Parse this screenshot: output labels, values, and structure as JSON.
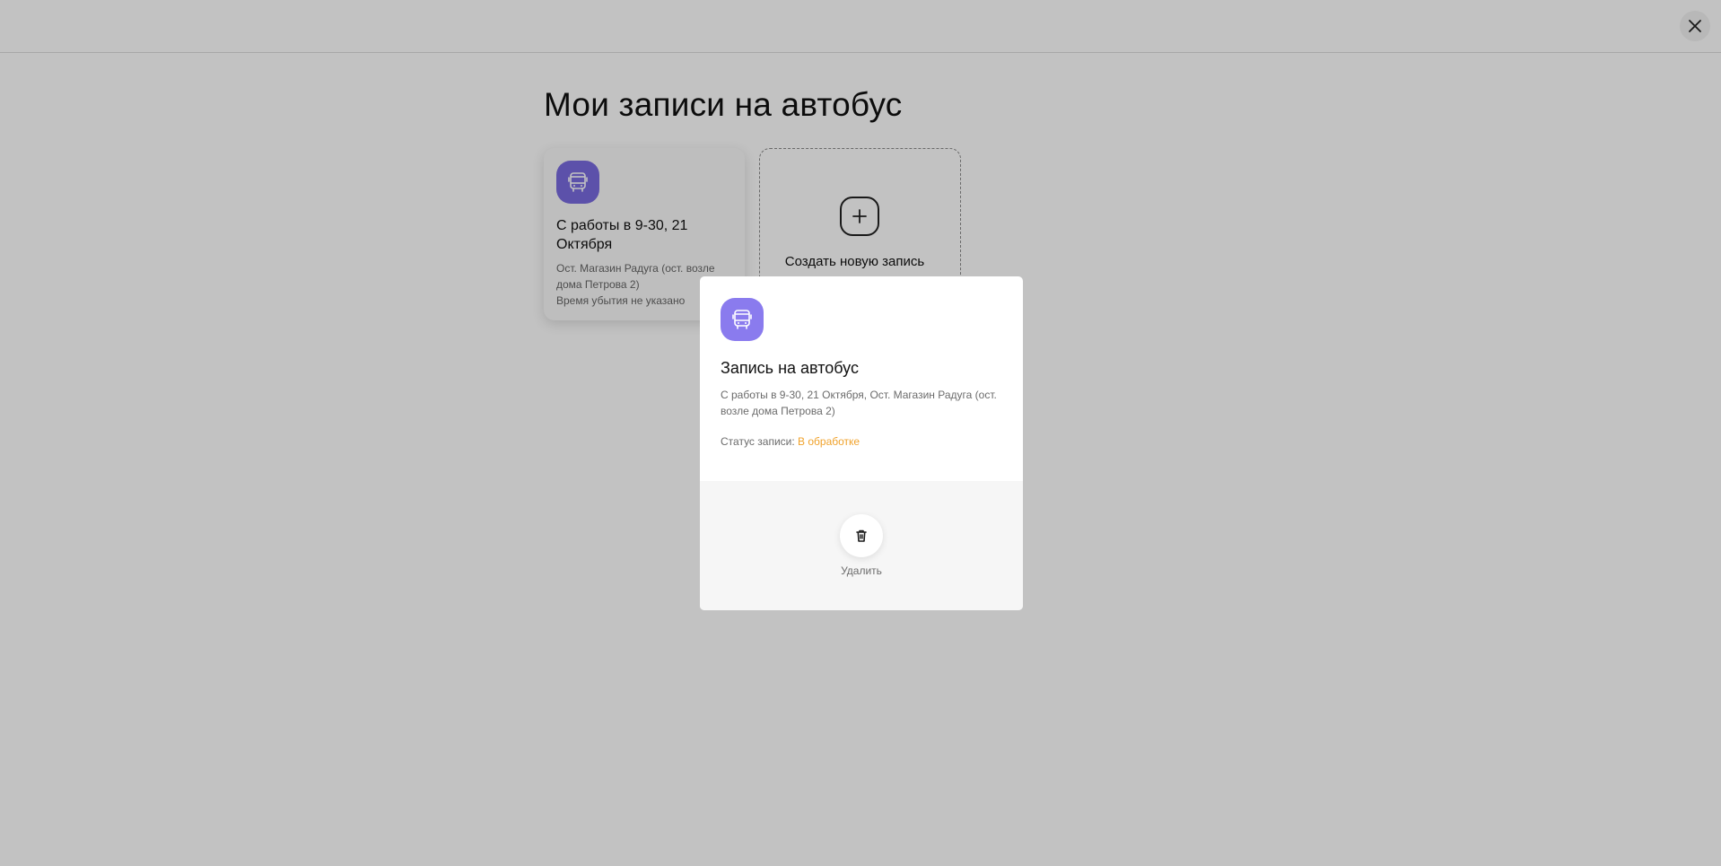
{
  "page": {
    "title": "Мои записи на автобус"
  },
  "header": {
    "close_icon": "close-icon"
  },
  "colors": {
    "accent_purple": "#7a6be0",
    "status_processing": "#f0a22b"
  },
  "bookings": [
    {
      "icon": "bus-icon",
      "title": "С работы в 9-30, 21 Октября",
      "stop": "Ост. Магазин Радуга (ост. возле дома Петрова 2)",
      "arrival": "Время убытия не указано"
    }
  ],
  "create_card": {
    "icon": "plus-icon",
    "label": "Создать новую запись"
  },
  "modal": {
    "icon": "bus-icon",
    "title": "Запись на автобус",
    "description": "С работы в 9-30, 21 Октября, Ост. Магазин Радуга (ост. возле дома Петрова 2)",
    "status_label": "Статус записи:",
    "status_value": "В обработке",
    "delete_icon": "trash-icon",
    "delete_label": "Удалить"
  }
}
